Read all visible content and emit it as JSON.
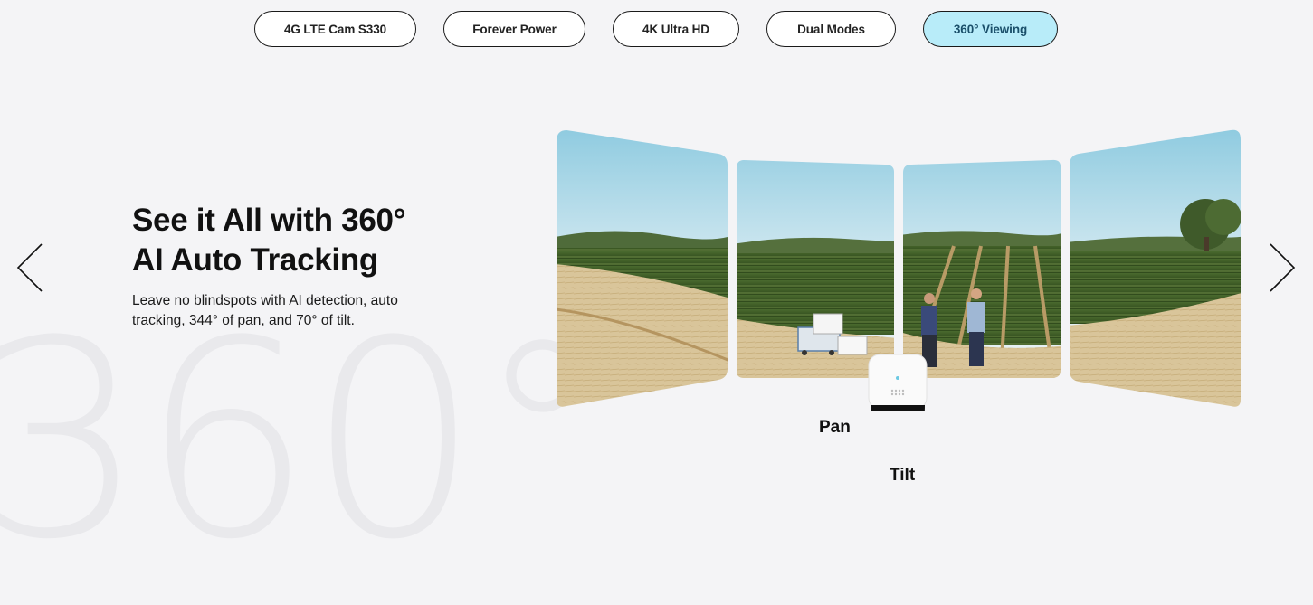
{
  "tabs": [
    {
      "label": "4G LTE Cam S330",
      "active": false
    },
    {
      "label": "Forever Power",
      "active": false
    },
    {
      "label": "4K Ultra HD",
      "active": false
    },
    {
      "label": "Dual Modes",
      "active": false
    },
    {
      "label": "360° Viewing",
      "active": true
    }
  ],
  "hero": {
    "watermark": "360°",
    "headline_line1": "See it All with 360°",
    "headline_line2": "AI Auto Tracking",
    "description": "Leave no blindspots with AI detection, auto tracking, 344° of pan, and 70° of tilt."
  },
  "camera": {
    "pan_label": "Pan",
    "tilt_label": "Tilt"
  },
  "nav": {
    "prev_icon": "chevron-left-icon",
    "next_icon": "chevron-right-icon"
  },
  "colors": {
    "background": "#f4f4f6",
    "active_tab": "#b8ecf9",
    "accent": "#5bc8e0"
  }
}
